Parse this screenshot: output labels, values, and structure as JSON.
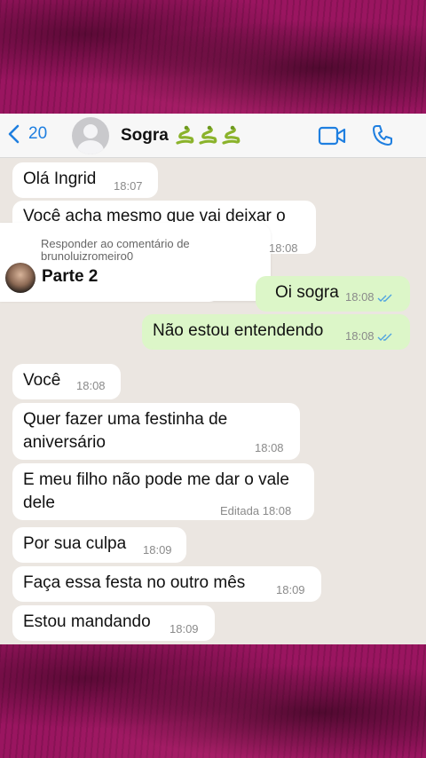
{
  "header": {
    "back_count": "20",
    "contact_name": "Sogra",
    "contact_emoji": "snake-emoji x3"
  },
  "messages": [
    {
      "id": "m1",
      "dir": "in",
      "text": "Olá Ingrid",
      "time": "18:07"
    },
    {
      "id": "m2",
      "dir": "in",
      "text": "Você acha mesmo que vai deixar o",
      "time": ""
    },
    {
      "id": "m3",
      "dir": "out",
      "text": "Oi sogra",
      "time": "18:08"
    },
    {
      "id": "m4",
      "dir": "out",
      "text": "Não estou entendendo",
      "time": "18:08"
    },
    {
      "id": "m5",
      "dir": "in",
      "text": "Você",
      "time": "18:08"
    },
    {
      "id": "m6",
      "dir": "in",
      "line1": "Quer fazer uma festinha de",
      "line2": "aniversário",
      "time": "18:08"
    },
    {
      "id": "m7",
      "dir": "in",
      "line1": "E meu filho não pode me dar o vale",
      "line2": "dele",
      "edited_label": "Editada",
      "time": "18:08"
    },
    {
      "id": "m8",
      "dir": "in",
      "text": "Por sua culpa",
      "time": "18:09"
    },
    {
      "id": "m9",
      "dir": "in",
      "text": "Faça essa festa no outro mês",
      "time": "18:09"
    },
    {
      "id": "m10",
      "dir": "in",
      "text": "Estou mandando",
      "time": "18:09"
    }
  ],
  "reply_overlay": {
    "caption": "Responder ao comentário de brunoluizromeiro0",
    "time": "18:08",
    "title": "Parte 2"
  },
  "colors": {
    "background": "#8a0f4e",
    "chat_bg": "#ebe6e1",
    "incoming": "#ffffff",
    "outgoing": "#dcf6c8",
    "accent": "#1f7fe0",
    "read_ticks": "#4fa3e0"
  }
}
